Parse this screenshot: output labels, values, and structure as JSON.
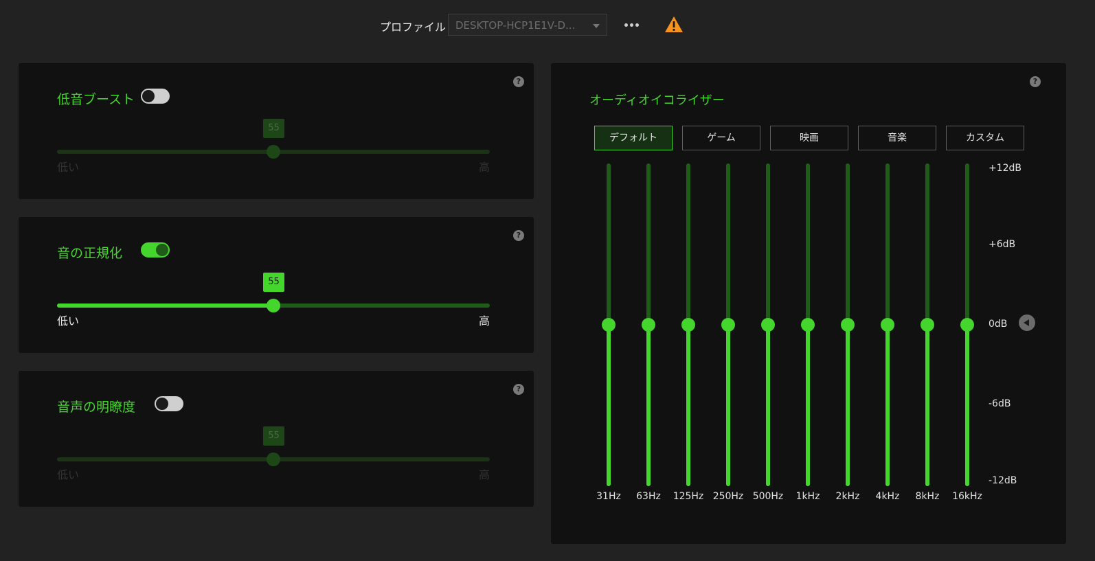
{
  "header": {
    "profile_label": "プロファイル",
    "profile_value": "DESKTOP-HCP1E1V-D...",
    "more_label": "•••"
  },
  "bass_boost": {
    "title": "低音ブースト",
    "enabled": false,
    "value": "55",
    "percent": 50,
    "low": "低い",
    "high": "高",
    "help": "?"
  },
  "sound_normalization": {
    "title": "音の正規化",
    "enabled": true,
    "value": "55",
    "percent": 50,
    "low": "低い",
    "high": "高",
    "help": "?"
  },
  "voice_clarity": {
    "title": "音声の明瞭度",
    "enabled": false,
    "value": "55",
    "percent": 50,
    "low": "低い",
    "high": "高",
    "help": "?"
  },
  "equalizer": {
    "title": "オーディオイコライザー",
    "help": "?",
    "presets": [
      "デフォルト",
      "ゲーム",
      "映画",
      "音楽",
      "カスタム"
    ],
    "active_preset": "デフォルト",
    "db_labels": [
      "+12dB",
      "+6dB",
      "0dB",
      "-6dB",
      "-12dB"
    ],
    "bands": [
      {
        "freq": "31Hz",
        "gain_db": 0
      },
      {
        "freq": "63Hz",
        "gain_db": 0
      },
      {
        "freq": "125Hz",
        "gain_db": 0
      },
      {
        "freq": "250Hz",
        "gain_db": 0
      },
      {
        "freq": "500Hz",
        "gain_db": 0
      },
      {
        "freq": "1kHz",
        "gain_db": 0
      },
      {
        "freq": "2kHz",
        "gain_db": 0
      },
      {
        "freq": "4kHz",
        "gain_db": 0
      },
      {
        "freq": "8kHz",
        "gain_db": 0
      },
      {
        "freq": "16kHz",
        "gain_db": 0
      }
    ]
  },
  "colors": {
    "accent": "#44d62c",
    "warning": "#f7941d",
    "background": "#222222",
    "card": "#111111"
  }
}
